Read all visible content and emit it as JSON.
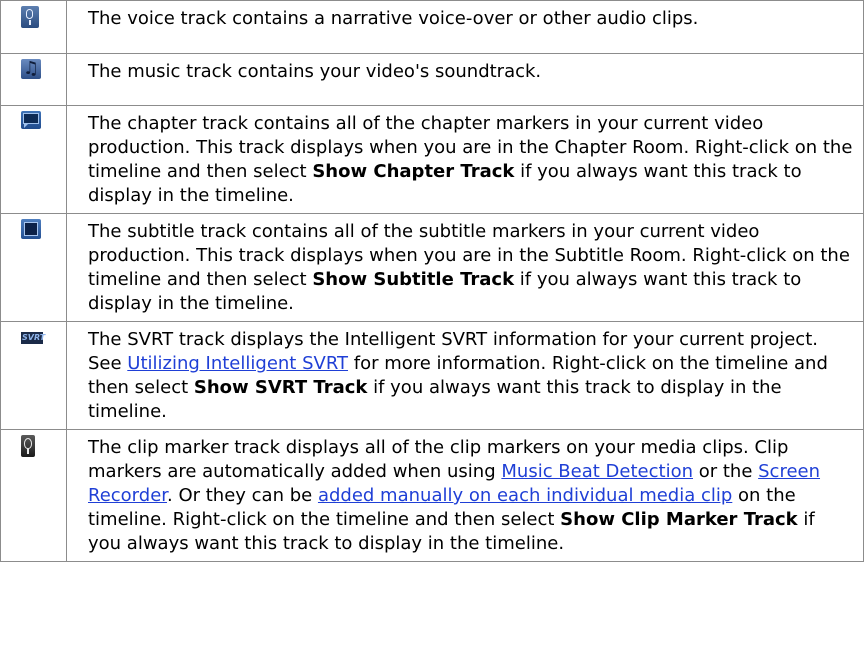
{
  "rows": [
    {
      "icon": "microphone-icon",
      "text": "The voice track contains a narrative voice-over or other audio clips."
    },
    {
      "icon": "music-notes-icon",
      "text": "The music track contains your video's soundtrack."
    },
    {
      "icon": "chapter-speech-bubble-icon",
      "text_a": "The chapter track contains all of the chapter markers in your current video production. This track displays when you are in the Chapter Room. Right-click on the timeline and then select ",
      "bold": "Show Chapter Track",
      "text_b": " if you always want this track to display in the timeline."
    },
    {
      "icon": "subtitle-box-icon",
      "text_a": "The subtitle track contains all of the subtitle markers in your current video production. This track displays when you are in the Subtitle Room. Right-click on the timeline and then select ",
      "bold": "Show Subtitle Track",
      "text_b": " if you always want this track to display in the timeline."
    },
    {
      "icon": "svrt-icon",
      "text_a": "The SVRT track displays the Intelligent SVRT information for your current project. See ",
      "link": "Utilizing Intelligent SVRT",
      "text_b": " for more information. Right-click on the timeline and then select ",
      "bold": "Show SVRT Track",
      "text_c": " if you always want this track to display in the timeline."
    },
    {
      "icon": "clip-marker-icon",
      "text_a": "The clip marker track displays all of the clip markers on your media clips. Clip markers are automatically added when using ",
      "link1": "Music Beat Detection",
      "text_b": " or the ",
      "link2": "Screen Recorder",
      "text_c": ". Or they can be ",
      "link3": "added manually on each individual media clip",
      "text_d": " on the timeline. Right-click on the timeline and then select ",
      "bold": "Show Clip Marker Track",
      "text_e": " if you always want this track to display in the timeline."
    }
  ]
}
